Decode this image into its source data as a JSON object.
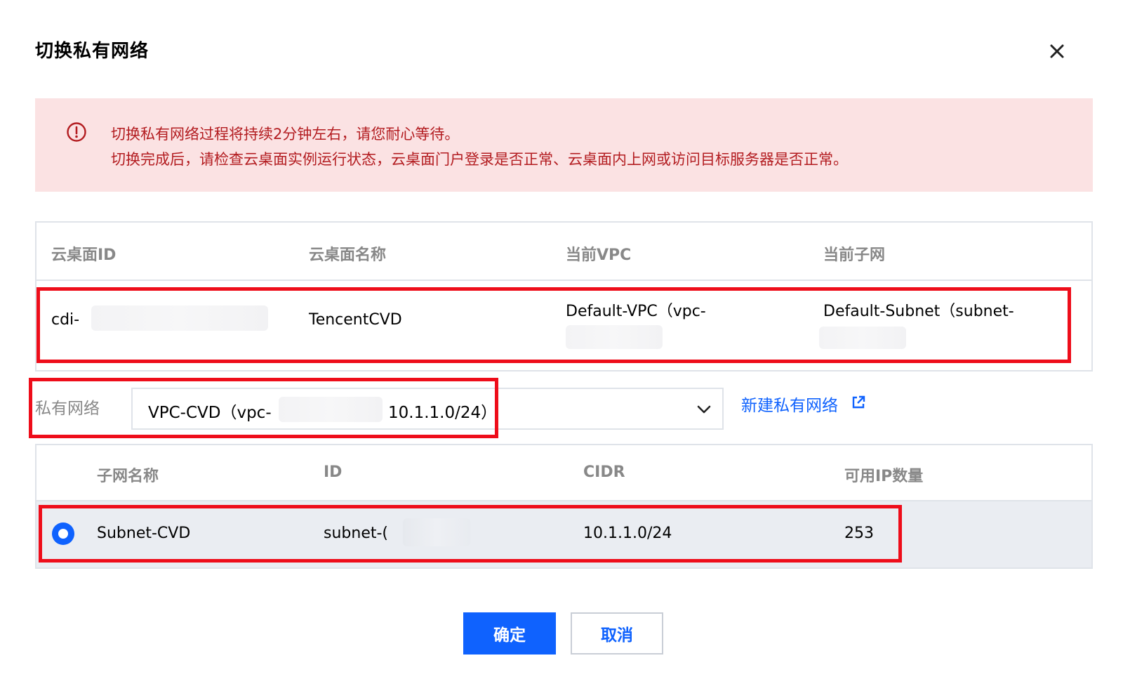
{
  "dialog": {
    "title": "切换私有网络",
    "close_icon": "close-icon"
  },
  "alert": {
    "icon": "exclamation-circle-icon",
    "line1": "切换私有网络过程将持续2分钟左右，请您耐心等待。",
    "line2": "切换完成后，请检查云桌面实例运行状态，云桌面门户登录是否正常、云桌面内上网或访问目标服务器是否正常。"
  },
  "current_table": {
    "headers": [
      "云桌面ID",
      "云桌面名称",
      "当前VPC",
      "当前子网"
    ],
    "row": {
      "id": "cdi-",
      "name": "TencentCVD",
      "vpc": "Default-VPC（vpc-",
      "subnet": "Default-Subnet（subnet-"
    }
  },
  "vpc_select": {
    "label": "私有网络",
    "value": "VPC-CVD（vpc-",
    "cidr": "10.1.1.0/24）",
    "new_link": "新建私有网络"
  },
  "subnet_table": {
    "headers": [
      "子网名称",
      "ID",
      "CIDR",
      "可用IP数量"
    ],
    "row": {
      "name": "Subnet-CVD",
      "id": "subnet-(",
      "cidr": "10.1.1.0/24",
      "available_ips": "253"
    }
  },
  "buttons": {
    "confirm": "确定",
    "cancel": "取消"
  },
  "colors": {
    "primary": "#0f62fe",
    "alert_bg": "#fbe2e3",
    "alert_text": "#b31c20",
    "highlight": "#ee0d1a"
  }
}
